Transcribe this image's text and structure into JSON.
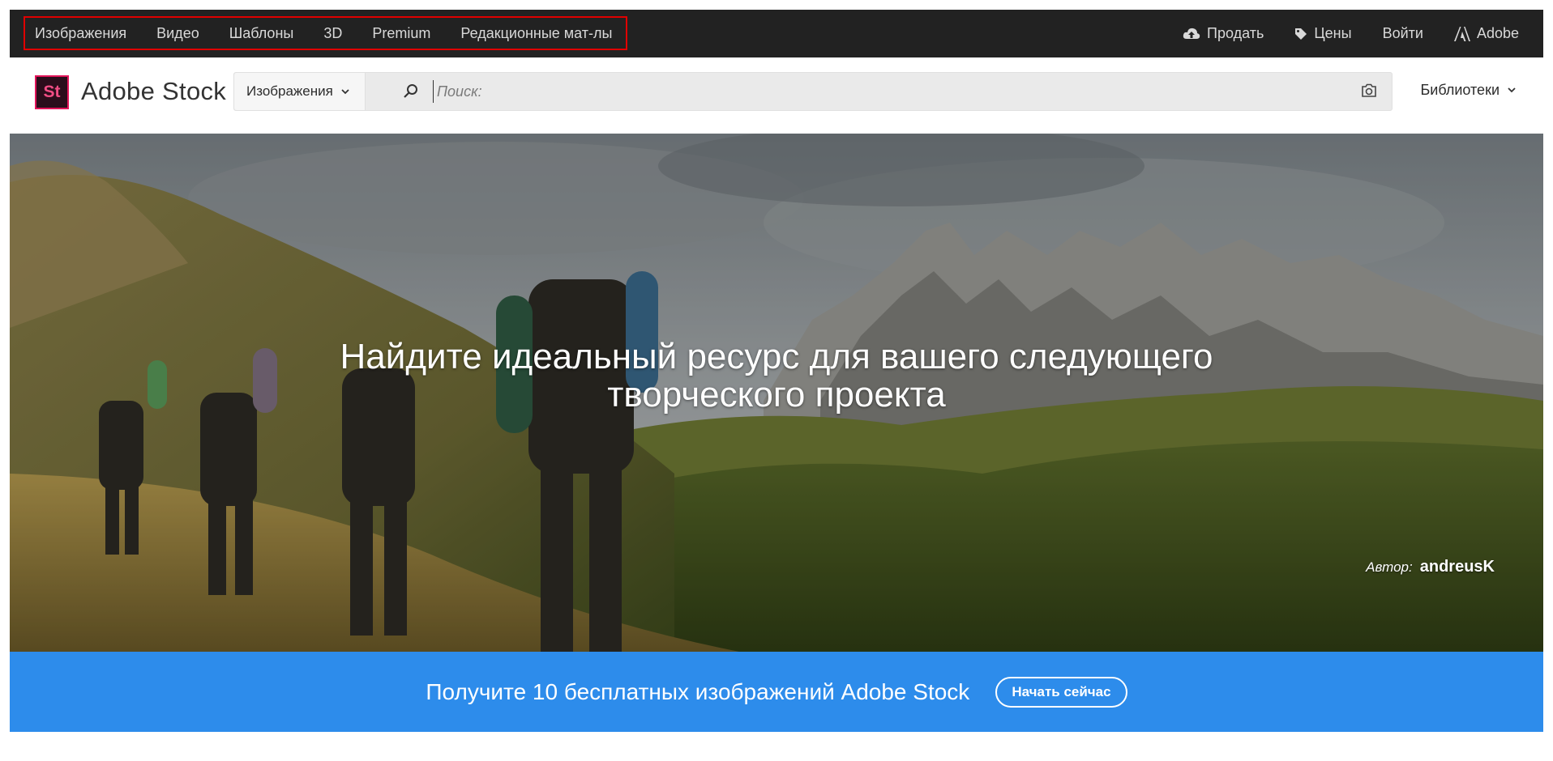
{
  "topnav": {
    "left_items": [
      "Изображения",
      "Видео",
      "Шаблоны",
      "3D",
      "Premium",
      "Редакционные мат-лы"
    ],
    "sell": "Продать",
    "pricing": "Цены",
    "sign_in": "Войти",
    "adobe": "Adobe"
  },
  "header": {
    "logo_mark": "St",
    "logo_text": "Adobe Stock",
    "search_type": "Изображения",
    "search_placeholder": "Поиск:",
    "libraries": "Библиотеки"
  },
  "hero": {
    "title_line1": "Найдите идеальный ресурс для вашего следующего",
    "title_line2": "творческого проекта",
    "credit_label": "Автор:",
    "credit_author": "andreusK"
  },
  "promo": {
    "text": "Получите 10 бесплатных изображений Adobe Stock",
    "button": "Начать сейчас"
  },
  "colors": {
    "nav_bg": "#222222",
    "highlight_border": "#e00000",
    "logo_accent": "#e2145a",
    "promo_bg": "#2d8ceb"
  }
}
